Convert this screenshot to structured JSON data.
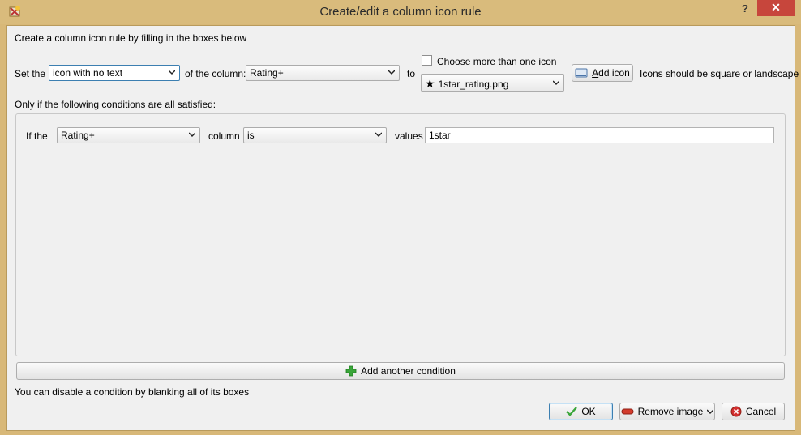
{
  "window": {
    "title": "Create/edit a column icon rule",
    "help_label": "?",
    "close_label": "✕"
  },
  "intro_text": "Create a column icon rule by filling in the boxes below",
  "rule_row": {
    "set_label": "Set the",
    "kind_value": "icon with no text",
    "of_column_label": "of the column:",
    "column_value": "Rating+",
    "to_label": "to",
    "choose_more_label": "Choose more than one icon",
    "choose_more_checked": false,
    "icon_value": "1star_rating.png",
    "add_icon_label_prefix": "A",
    "add_icon_label_rest": "dd icon",
    "icons_hint": "Icons should be square or landscape"
  },
  "conditions_label": "Only if the following conditions are all satisfied:",
  "condition": {
    "if_the_label": "If the",
    "column_value": "Rating+",
    "column_label": "column",
    "operator_value": "is",
    "values_label": "values",
    "values_value": "1star"
  },
  "add_condition_label": "Add another condition",
  "disable_hint": "You can disable a condition by blanking all of its boxes",
  "buttons": {
    "ok": "OK",
    "remove_image": "Remove image",
    "cancel": "Cancel"
  },
  "colors": {
    "title_bar": "#d9bb7c",
    "close_button": "#c7463c",
    "dialog_bg": "#f0f0f0",
    "focus_border": "#3c7fb1"
  }
}
